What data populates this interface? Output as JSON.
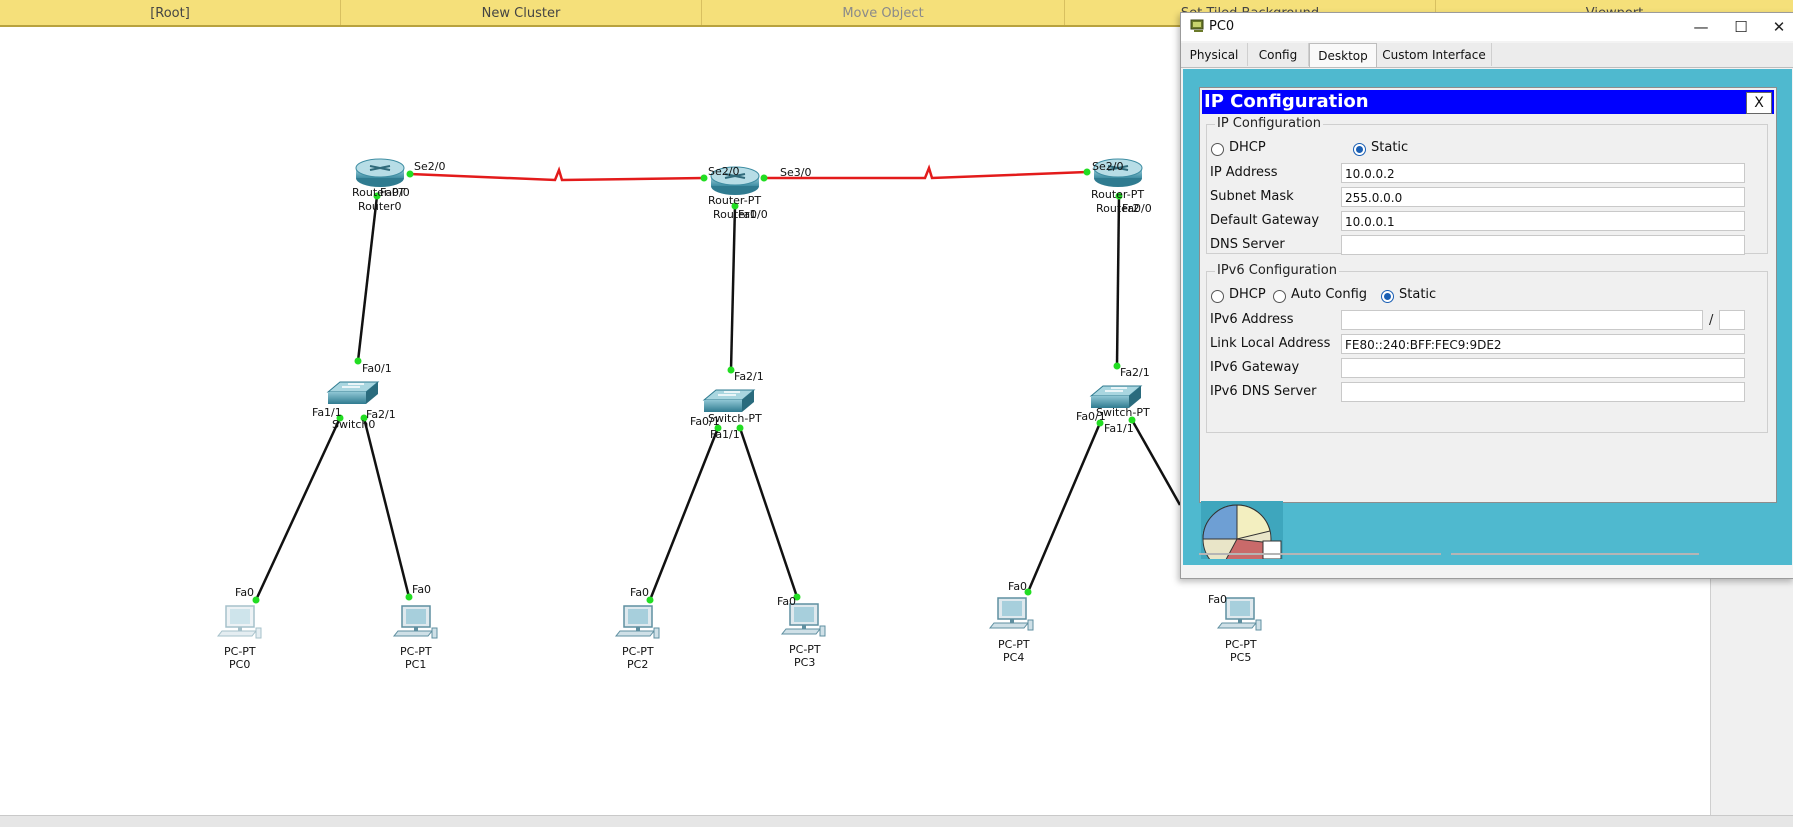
{
  "toolbar": {
    "root": "[Root]",
    "new_cluster": "New Cluster",
    "move_object": "Move Object",
    "set_tiled": "Set Tiled Background",
    "viewport": "Viewport"
  },
  "topology": {
    "routers": [
      {
        "model": "Router-PT",
        "name": "Router0",
        "port_se": "Se2/0",
        "port_fa": "Fa0/0"
      },
      {
        "model": "Router-PT",
        "name": "Router1",
        "port_se_left": "Se2/0",
        "port_se_right": "Se3/0",
        "port_fa": "Fa0/0"
      },
      {
        "model": "Router-PT",
        "name": "Router2",
        "port_se": "Se2/0",
        "port_fa": "Fa0/0"
      }
    ],
    "switches": [
      {
        "model": "Switch-PT",
        "name": "Switch0",
        "uplink": "Fa0/1",
        "p1": "Fa1/1",
        "p2": "Fa2/1"
      },
      {
        "model": "Switch-PT",
        "name": "Switch1",
        "uplink": "Fa2/1",
        "p1": "Fa0/1",
        "p2": "Fa1/1"
      },
      {
        "model": "Switch-PT",
        "name": "Switch2",
        "uplink": "Fa2/1",
        "p1": "Fa0/1",
        "p2": "Fa1/1"
      }
    ],
    "pcs": [
      {
        "model": "PC-PT",
        "name": "PC0",
        "port": "Fa0"
      },
      {
        "model": "PC-PT",
        "name": "PC1",
        "port": "Fa0"
      },
      {
        "model": "PC-PT",
        "name": "PC2",
        "port": "Fa0"
      },
      {
        "model": "PC-PT",
        "name": "PC3",
        "port": "Fa0"
      },
      {
        "model": "PC-PT",
        "name": "PC4",
        "port": "Fa0"
      },
      {
        "model": "PC-PT",
        "name": "PC5",
        "port": "Fa0"
      }
    ]
  },
  "window": {
    "title": "PC0",
    "minimize": "—",
    "maximize": "☐",
    "close": "✕",
    "tabs": [
      "Physical",
      "Config",
      "Desktop",
      "Custom Interface"
    ],
    "active_tab": "Desktop"
  },
  "ipconfig": {
    "header": "IP Configuration",
    "close_label": "X",
    "ipv4_group": "IP Configuration",
    "dhcp_label": "DHCP",
    "static_label": "Static",
    "mode": "Static",
    "ip_label": "IP Address",
    "ip_value": "10.0.0.2",
    "mask_label": "Subnet Mask",
    "mask_value": "255.0.0.0",
    "gw_label": "Default Gateway",
    "gw_value": "10.0.0.1",
    "dns_label": "DNS Server",
    "dns_value": "",
    "ipv6_group": "IPv6 Configuration",
    "ipv6_dhcp_label": "DHCP",
    "ipv6_auto_label": "Auto Config",
    "ipv6_static_label": "Static",
    "ipv6_mode": "Static",
    "ipv6_addr_label": "IPv6 Address",
    "ipv6_addr_value": "",
    "prefix_sep": "/",
    "ipv6_prefix_value": "",
    "lla_label": "Link Local Address",
    "lla_value": "FE80::240:BFF:FEC9:9DE2",
    "ipv6_gw_label": "IPv6 Gateway",
    "ipv6_gw_value": "",
    "ipv6_dns_label": "IPv6 DNS Server",
    "ipv6_dns_value": ""
  },
  "colors": {
    "serial_link": "#e31b1b",
    "ethernet_link": "#111111",
    "port_up": "#22dd22",
    "topbar": "#f5e07a",
    "desktop_bg": "#4fb9cf",
    "config_header": "#0000ff"
  }
}
